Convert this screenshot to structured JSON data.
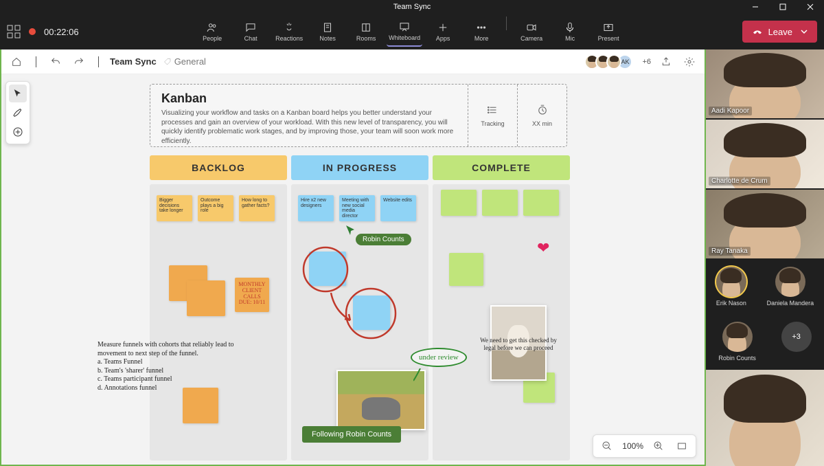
{
  "window": {
    "title": "Team Sync"
  },
  "meeting": {
    "timer": "00:22:06",
    "tools": {
      "people": "People",
      "chat": "Chat",
      "reactions": "Reactions",
      "notes": "Notes",
      "rooms": "Rooms",
      "whiteboard": "Whiteboard",
      "apps": "Apps",
      "more": "More",
      "camera": "Camera",
      "mic": "Mic",
      "present": "Present"
    },
    "leave_label": "Leave"
  },
  "wb_header": {
    "title": "Team Sync",
    "channel": "General",
    "overflow": "+6"
  },
  "presence_avatars": [
    "",
    "",
    "",
    "AK"
  ],
  "kanban": {
    "title": "Kanban",
    "description": "Visualizing your workflow and tasks on a Kanban board helps you better understand your processes and gain an overview of your workload. With this new level of transparency, you will quickly identify problematic work stages, and by improving those, your team will soon work more efficiently.",
    "tracking_label": "Tracking",
    "time_label": "XX min"
  },
  "columns": {
    "backlog": "BACKLOG",
    "progress": "IN PROGRESS",
    "complete": "COMPLETE"
  },
  "notes": {
    "backlog1": "Bigger decisions take longer",
    "backlog2": "Outcome plays a big role",
    "backlog3": "How long to gather facts?",
    "backlog_hand": "MONTHLY CLIENT CALLS DUE: 10/11",
    "progress1": "Hire x2 new designers",
    "progress2": "Meeting with new social media director",
    "progress3": "Website edits",
    "under_review": "under review",
    "legal_note": "We need to get this checked by legal before we can proceed"
  },
  "annotations": {
    "funnel": "Measure funnels with cohorts that reliably lead to movement to next step of the funnel.\n   a. Teams Funnel\n   b. Team's 'sharer' funnel\n   c. Teams participant funnel\n   d. Annotations funnel"
  },
  "cursor_tag": "Robin Counts",
  "following_label": "Following Robin Counts",
  "zoom": {
    "value": "100%"
  },
  "participants": {
    "p1": "Aadi Kapoor",
    "p2": "Charlotte de Crum",
    "p3": "Ray Tanaka",
    "p4": "Erik Nason",
    "p5": "Daniela Mandera",
    "p6": "Robin Counts",
    "overflow": "+3"
  }
}
